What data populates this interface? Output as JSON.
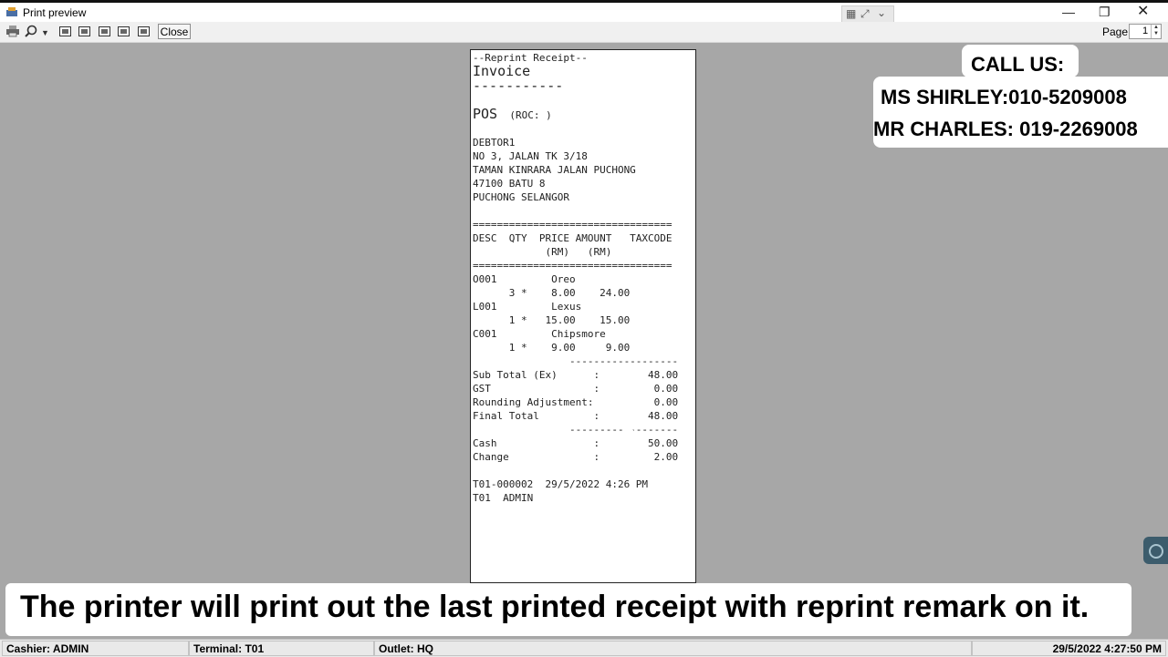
{
  "window": {
    "title": "Print preview"
  },
  "toolbar": {
    "close_label": "Close",
    "page_label": "Page",
    "page_value": "1"
  },
  "receipt": {
    "header": "--Reprint Receipt--",
    "doc_title": "Invoice",
    "title_rule": "-----------",
    "company": "POS",
    "roc": "(ROC: )",
    "address": [
      "DEBTOR1",
      "NO 3, JALAN TK 3/18",
      "TAMAN KINRARA JALAN PUCHONG",
      "47100 BATU 8",
      "PUCHONG SELANGOR"
    ],
    "double_rule": "=================================",
    "columns_line1": "DESC  QTY  PRICE AMOUNT   TAXCODE",
    "columns_line2": "            (RM)   (RM)",
    "items": [
      {
        "code": "O001",
        "name": "Oreo",
        "qty_line": "      3 *    8.00    24.00"
      },
      {
        "code": "L001",
        "name": "Lexus",
        "qty_line": "      1 *   15.00    15.00"
      },
      {
        "code": "C001",
        "name": "Chipsmore",
        "qty_line": "      1 *    9.00     9.00"
      }
    ],
    "single_rule": "                ------------------",
    "totals": [
      "Sub Total (Ex)      :        48.00",
      "GST                 :         0.00",
      "Rounding Adjustment:          0.00",
      "Final Total         :        48.00"
    ],
    "payments": [
      "Cash                :        50.00",
      "Change              :         2.00"
    ],
    "footer": [
      "T01-000002  29/5/2022 4:26 PM",
      "T01  ADMIN"
    ]
  },
  "overlay": {
    "call_title": "CALL US:",
    "contact1": "MS SHIRLEY:010-5209008",
    "contact2": "MR CHARLES: 019-2269008",
    "caption": "The printer will print out the last printed receipt with reprint remark on it."
  },
  "statusbar": {
    "cashier": "Cashier: ADMIN",
    "terminal": "Terminal: T01",
    "outlet": "Outlet: HQ",
    "datetime": "29/5/2022 4:27:50 PM"
  },
  "icons": [
    "printer-icon",
    "zoom-icon",
    "chevron-down-icon",
    "view-icon",
    "minimize-icon",
    "restore-icon",
    "close-icon"
  ]
}
